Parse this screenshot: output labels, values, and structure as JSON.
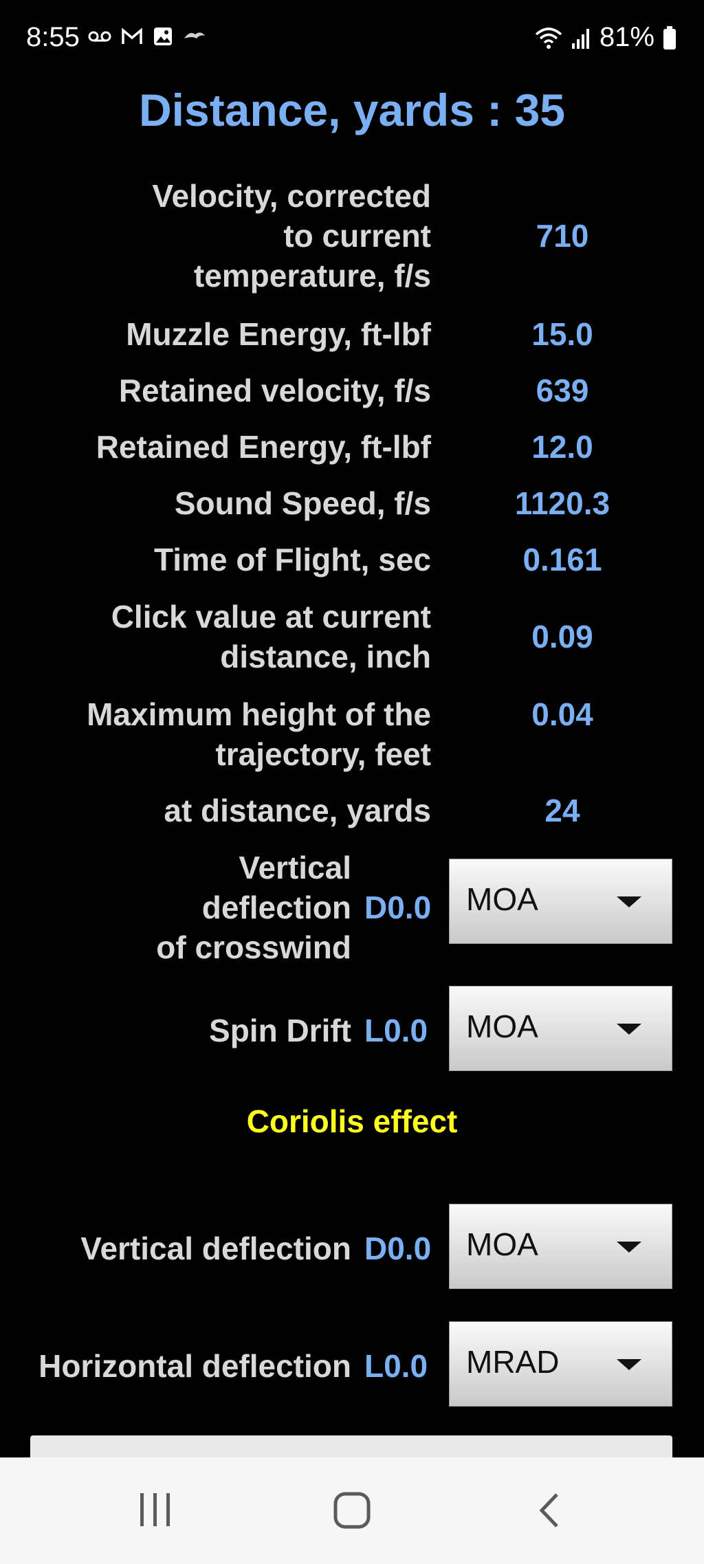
{
  "status": {
    "time": "8:55",
    "battery": "81%",
    "left_icons": [
      "voicemail-icon",
      "gmail-icon",
      "gallery-icon",
      "bird-icon"
    ],
    "right_icons": [
      "wifi-icon",
      "signal-icon",
      "battery-icon"
    ]
  },
  "header": {
    "title": "Distance, yards : 35"
  },
  "results": [
    {
      "label_lines": [
        "Velocity, corrected",
        "to current",
        "temperature, f/s"
      ],
      "value": "710"
    },
    {
      "label_lines": [
        "Muzzle Energy, ft-lbf"
      ],
      "value": "15.0"
    },
    {
      "label_lines": [
        "Retained velocity, f/s"
      ],
      "value": "639"
    },
    {
      "label_lines": [
        "Retained Energy, ft-lbf"
      ],
      "value": "12.0"
    },
    {
      "label_lines": [
        "Sound Speed, f/s"
      ],
      "value": "1120.3"
    },
    {
      "label_lines": [
        "Time of Flight, sec"
      ],
      "value": "0.161"
    },
    {
      "label_lines": [
        "Click value at current",
        "distance, inch"
      ],
      "value": "0.09"
    },
    {
      "label_lines": [
        "Maximum height of the",
        "trajectory, feet"
      ],
      "value": "0.04"
    },
    {
      "label_lines": [
        "at distance, yards"
      ],
      "value": "24"
    }
  ],
  "crosswind": {
    "label_lines": [
      "Vertical",
      "deflection",
      "of crosswind"
    ],
    "value": "D0.0",
    "unit": "MOA"
  },
  "spin_drift": {
    "label": "Spin Drift",
    "value": "L0.0",
    "unit": "MOA"
  },
  "coriolis": {
    "title": "Coriolis effect",
    "vertical": {
      "label": "Vertical deflection",
      "value": "D0.0",
      "unit": "MOA"
    },
    "horizontal": {
      "label": "Horizontal deflection",
      "value": "L0.0",
      "unit": "MRAD"
    }
  },
  "nav": {
    "icons": [
      "recent-apps-icon",
      "home-icon",
      "back-icon"
    ]
  }
}
